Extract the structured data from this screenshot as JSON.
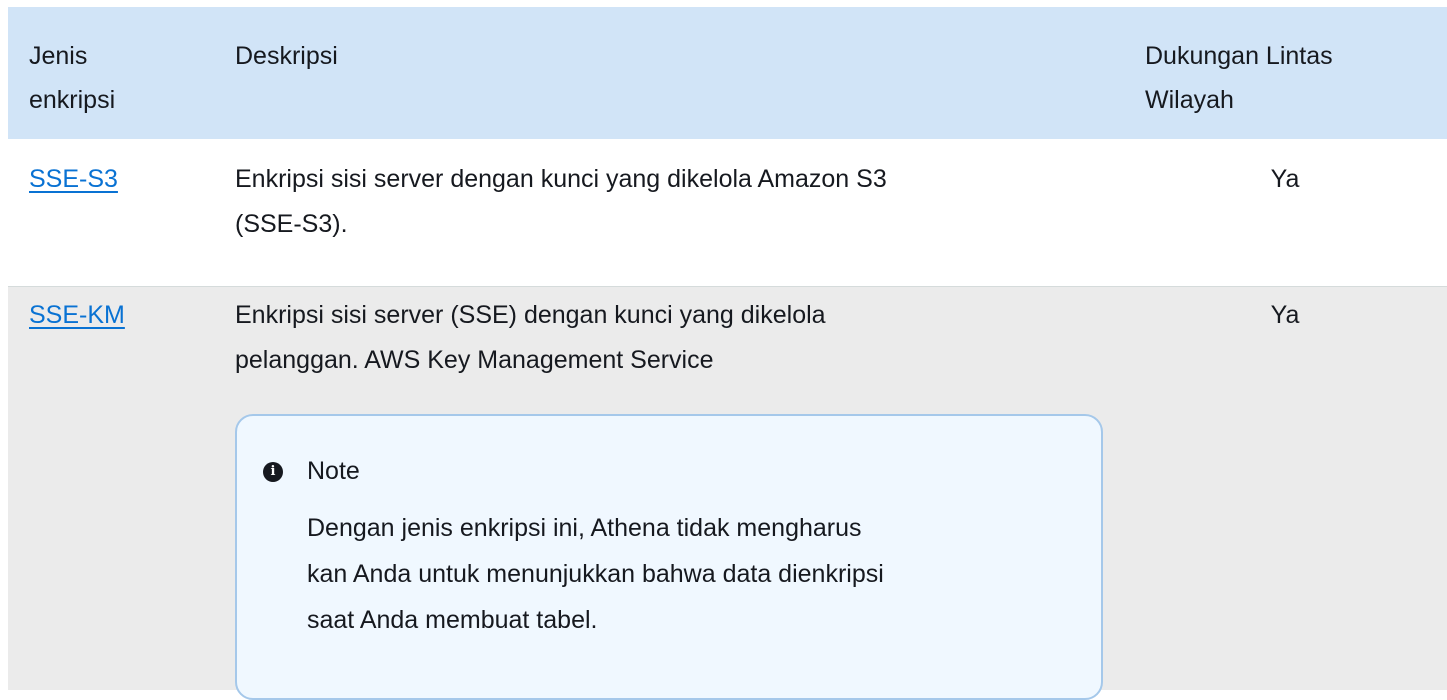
{
  "table": {
    "headers": {
      "type_line1": "Jenis",
      "type_line2": "enkripsi",
      "description": "Deskripsi",
      "cross_region_line1": "Dukungan Lintas",
      "cross_region_line2": "Wilayah"
    },
    "rows": [
      {
        "type_link": "SSE-S3",
        "description_line1": "Enkripsi sisi server dengan kunci yang dikelola Amazon S3",
        "description_line2": "(SSE-S3).",
        "cross_region": "Ya"
      },
      {
        "type_link": "SSE-KM",
        "description_line1": "Enkripsi sisi server (SSE) dengan kunci yang dikelola",
        "description_line2": "pelanggan. AWS Key Management Service",
        "cross_region": "Ya",
        "note": {
          "icon": "info-icon",
          "title": "Note",
          "body_line1": "Dengan jenis enkripsi ini, Athena tidak mengharus",
          "body_line2": "kan Anda untuk menunjukkan bahwa data dienkripsi",
          "body_line3": "saat Anda membuat tabel."
        }
      }
    ]
  }
}
